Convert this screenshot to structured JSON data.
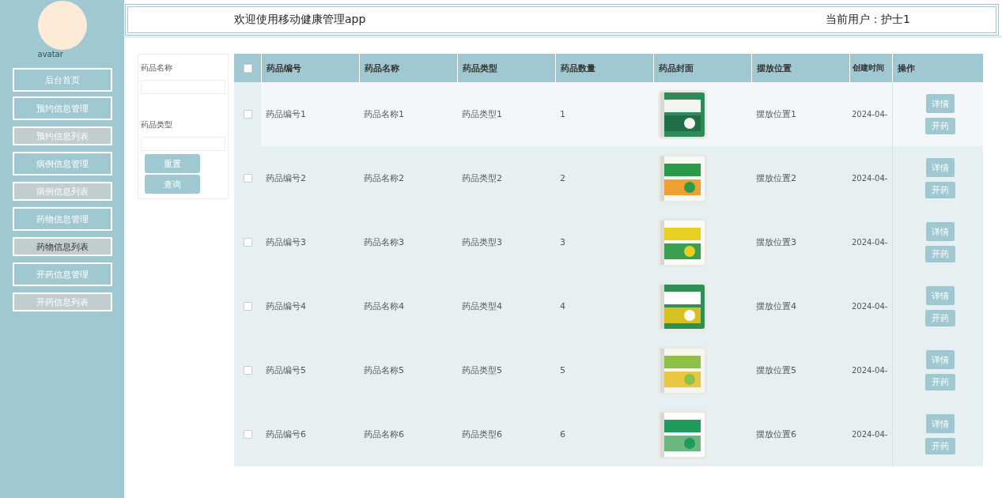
{
  "sidebar": {
    "avatar_alt": "avatar",
    "items": [
      {
        "label": "后台首页",
        "kind": "menu",
        "selected": false
      },
      {
        "label": "预约信息管理",
        "kind": "menu",
        "selected": false
      },
      {
        "label": "预约信息列表",
        "kind": "submenu",
        "selected": false
      },
      {
        "label": "病例信息管理",
        "kind": "menu",
        "selected": false
      },
      {
        "label": "病例信息列表",
        "kind": "submenu",
        "selected": false
      },
      {
        "label": "药物信息管理",
        "kind": "menu",
        "selected": false
      },
      {
        "label": "药物信息列表",
        "kind": "submenu",
        "selected": true
      },
      {
        "label": "开药信息管理",
        "kind": "menu",
        "selected": false
      },
      {
        "label": "开药信息列表",
        "kind": "submenu",
        "selected": false
      }
    ]
  },
  "header": {
    "title": "欢迎使用移动健康管理app",
    "user": "当前用户：护士1"
  },
  "search": {
    "fields": [
      {
        "label": "药品名称"
      },
      {
        "label": "药品类型"
      }
    ],
    "buttons": [
      "重置",
      "查询"
    ]
  },
  "table": {
    "columns": [
      "药品编号",
      "药品名称",
      "药品类型",
      "药品数量",
      "药品封面",
      "摆放位置",
      "创建时间",
      "操作"
    ],
    "all_checked": false,
    "rows": [
      {
        "checked": false,
        "hovered": true,
        "cells": [
          "药品编号1",
          "药品名称1",
          "药品类型1",
          "1"
        ],
        "place": "摆放位置1",
        "created": "2024-04-",
        "actions": [
          "详情",
          "开药"
        ]
      },
      {
        "checked": false,
        "hovered": false,
        "cells": [
          "药品编号2",
          "药品名称2",
          "药品类型2",
          "2"
        ],
        "place": "摆放位置2",
        "created": "2024-04-",
        "actions": [
          "详情",
          "开药"
        ]
      },
      {
        "checked": false,
        "hovered": false,
        "cells": [
          "药品编号3",
          "药品名称3",
          "药品类型3",
          "3"
        ],
        "place": "摆放位置3",
        "created": "2024-04-",
        "actions": [
          "详情",
          "开药"
        ]
      },
      {
        "checked": false,
        "hovered": false,
        "cells": [
          "药品编号4",
          "药品名称4",
          "药品类型4",
          "4"
        ],
        "place": "摆放位置4",
        "created": "2024-04-",
        "actions": [
          "详情",
          "开药"
        ]
      },
      {
        "checked": false,
        "hovered": false,
        "cells": [
          "药品编号5",
          "药品名称5",
          "药品类型5",
          "5"
        ],
        "place": "摆放位置5",
        "created": "2024-04-",
        "actions": [
          "详情",
          "开药"
        ]
      },
      {
        "checked": false,
        "hovered": false,
        "cells": [
          "药品编号6",
          "药品名称6",
          "药品类型6",
          "6"
        ],
        "place": "摆放位置6",
        "created": "2024-04-",
        "actions": [
          "详情",
          "开药"
        ]
      }
    ]
  }
}
